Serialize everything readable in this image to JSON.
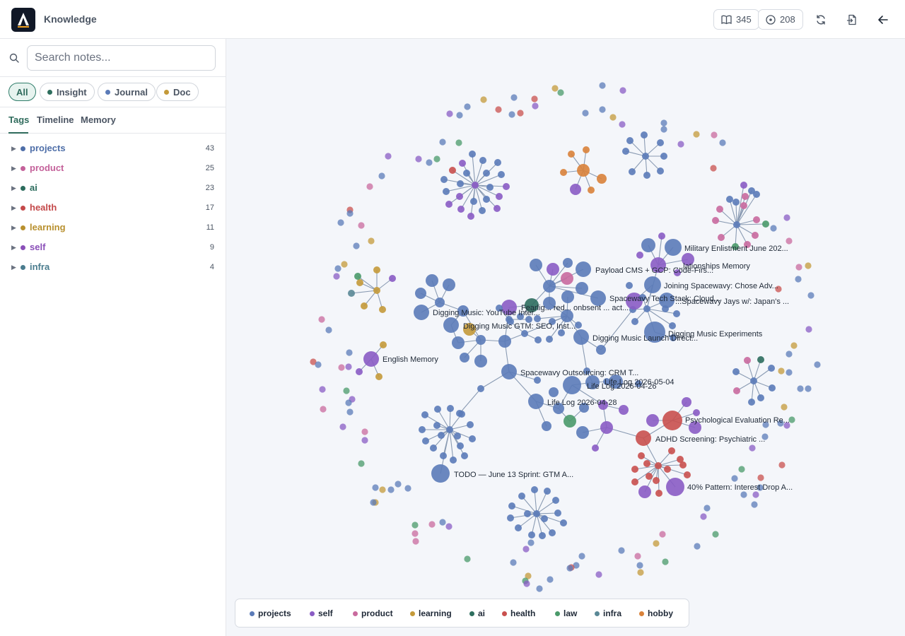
{
  "header": {
    "app_title": "Knowledge",
    "notes_count": "345",
    "sessions_count": "208",
    "icons": {
      "notes": "book-open-icon",
      "sessions": "circle-play-icon",
      "refresh": "refresh-icon",
      "import": "file-import-icon",
      "back": "arrow-left-icon"
    }
  },
  "search": {
    "placeholder": "Search notes..."
  },
  "filters": [
    {
      "label": "All",
      "color": ""
    },
    {
      "label": "Insight",
      "color": "#2e6e5e"
    },
    {
      "label": "Journal",
      "color": "#5b7bb8"
    },
    {
      "label": "Doc",
      "color": "#c49a3a"
    }
  ],
  "tabs": [
    {
      "label": "Tags"
    },
    {
      "label": "Timeline"
    },
    {
      "label": "Memory"
    }
  ],
  "tags": [
    {
      "label": "projects",
      "count": "43",
      "color": "#4e6ea8"
    },
    {
      "label": "product",
      "count": "25",
      "color": "#c4619a"
    },
    {
      "label": "ai",
      "count": "23",
      "color": "#2b6b5c"
    },
    {
      "label": "health",
      "count": "17",
      "color": "#c4494a"
    },
    {
      "label": "learning",
      "count": "11",
      "color": "#b8902e"
    },
    {
      "label": "self",
      "count": "9",
      "color": "#8a4fb8"
    },
    {
      "label": "infra",
      "count": "4",
      "color": "#4a7c8e"
    }
  ],
  "graph_labels": {
    "military": "Military Enlistment June 202...",
    "relationships": "...lationships Memory",
    "payload": "Payload CMS + GCP: Code-Firs...",
    "joining": "Joining Spacewavy: Chose Adv...",
    "techstack": "Spacewavy Tech Stack: Cloud...",
    "japan": "...Spacewavy Jays w/: Japan's ...",
    "youtube": "Digging Music: YouTube Inter...",
    "fearless": "Fearlig... red... onbsent ... act...",
    "gtm": "Digging Music GTM: SEO, Inst...",
    "launch": "Digging Music Launch Direct...",
    "experiments": "Digging Music Experiments",
    "english": "English Memory",
    "outsourcing": "Spacewavy Outsourcing: CRM T...",
    "lifelog0504": "Life Log 2026-05-04",
    "lifelog0426": "Life Log 2026-04-26",
    "lifelog0428": "Life Log 2026-04-28",
    "psych": "Psychological Evaluation Re...",
    "adhd": "ADHD Screening: Psychiatric ...",
    "todo": "TODO — June 13 Sprint: GTM A...",
    "pattern": "40% Pattern: Interest Drop A..."
  },
  "legend": [
    {
      "label": "projects",
      "color": "#5b7bb8"
    },
    {
      "label": "self",
      "color": "#8a5cc4"
    },
    {
      "label": "product",
      "color": "#c96a9e"
    },
    {
      "label": "learning",
      "color": "#c49a3a"
    },
    {
      "label": "ai",
      "color": "#2e6e5e"
    },
    {
      "label": "health",
      "color": "#c9504e"
    },
    {
      "label": "law",
      "color": "#4a9a6a"
    },
    {
      "label": "infra",
      "color": "#5a8896"
    },
    {
      "label": "hobby",
      "color": "#d9823a"
    }
  ]
}
